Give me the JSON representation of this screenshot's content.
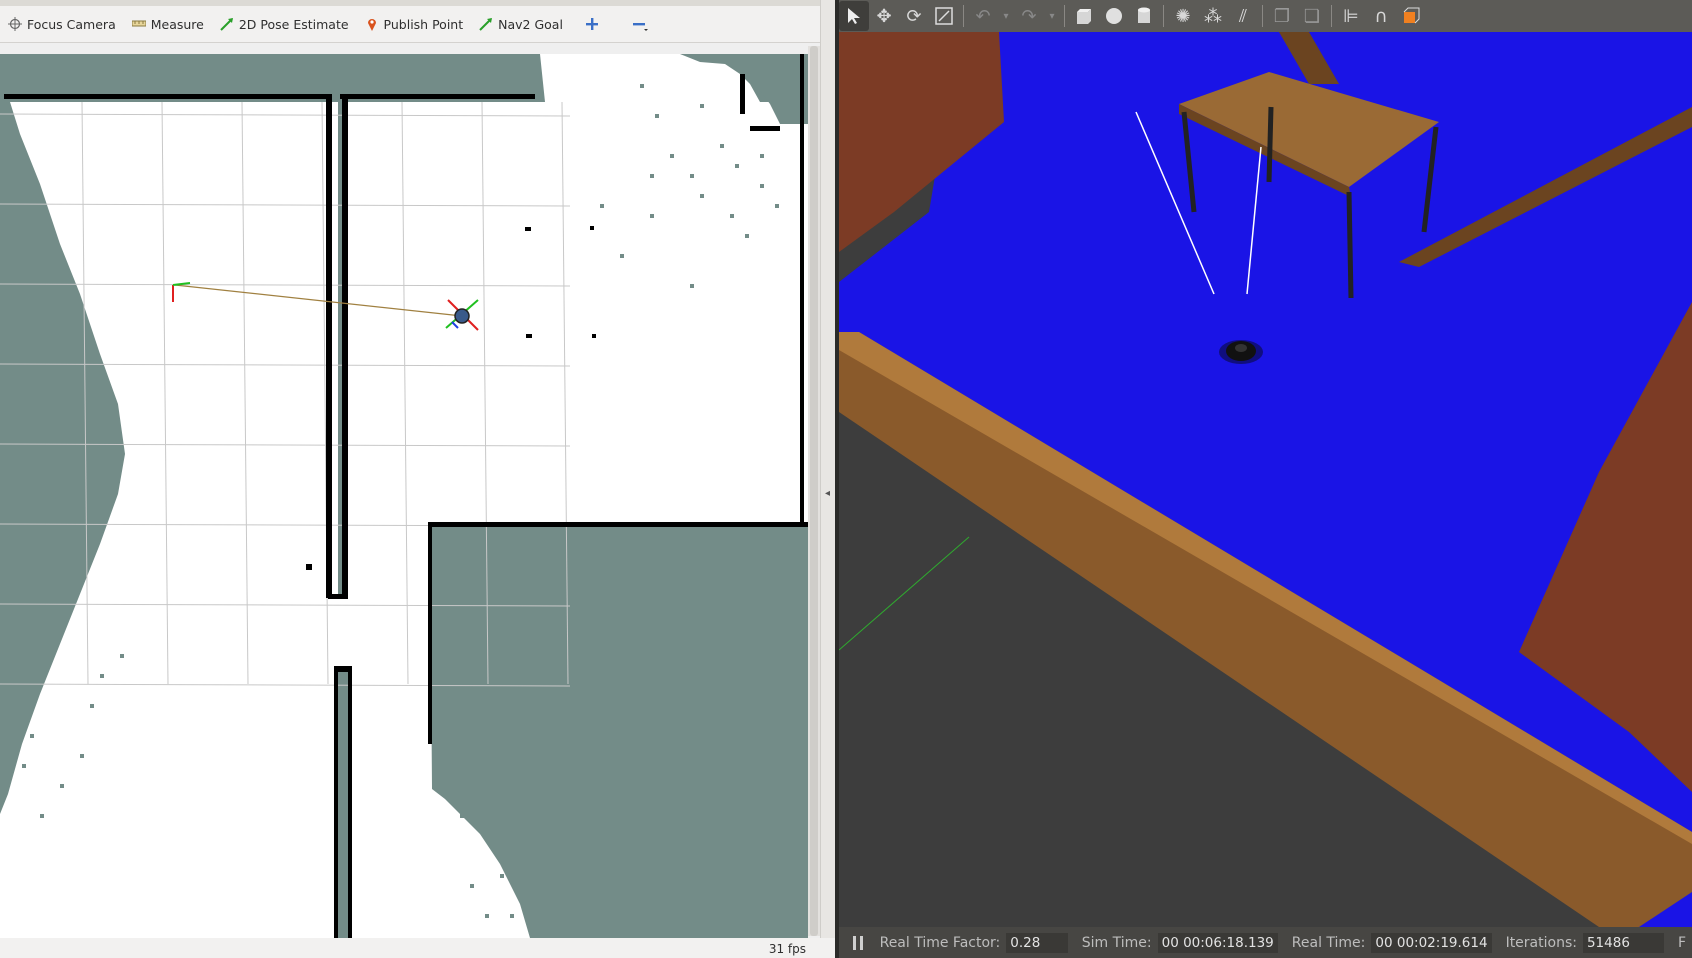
{
  "rviz": {
    "toolbar": [
      {
        "id": "focus-camera",
        "label": "Focus Camera",
        "icon": "crosshair-icon"
      },
      {
        "id": "measure",
        "label": "Measure",
        "icon": "ruler-icon"
      },
      {
        "id": "pose-estimate",
        "label": "2D Pose Estimate",
        "icon": "green-arrow-icon"
      },
      {
        "id": "publish-point",
        "label": "Publish Point",
        "icon": "map-pin-icon"
      },
      {
        "id": "nav2-goal",
        "label": "Nav2 Goal",
        "icon": "green-arrow-icon"
      }
    ],
    "add_tool_icon": "plus-icon",
    "remove_tool_icon": "minus-icon",
    "fps": "31 fps",
    "colors": {
      "unknown": "#738c88",
      "free": "#ffffff",
      "occupied": "#000000",
      "grid": "#c8c8c8",
      "path": "#a08040"
    }
  },
  "gazebo": {
    "toolbar_icons": [
      "select-arrow-icon",
      "translate-icon",
      "rotate-icon",
      "scale-icon",
      "undo-icon",
      "undo-dropdown-icon",
      "redo-icon",
      "redo-dropdown-icon",
      "box-icon",
      "sphere-icon",
      "cylinder-icon",
      "point-light-icon",
      "spot-light-icon",
      "directional-light-icon",
      "copy-icon",
      "paste-icon",
      "align-icon",
      "snap-icon",
      "view-angle-icon"
    ],
    "status": {
      "rtf_label": "Real Time Factor:",
      "rtf_value": "0.28",
      "sim_label": "Sim Time:",
      "sim_value": "00 00:06:18.139",
      "real_label": "Real Time:",
      "real_value": "00 00:02:19.614",
      "iter_label": "Iterations:",
      "iter_value": "51486",
      "fps_label": "F"
    },
    "colors": {
      "floor": "#1a14e6",
      "wall_wood": "#8a5a2b",
      "background": "#3d3d3d"
    }
  }
}
